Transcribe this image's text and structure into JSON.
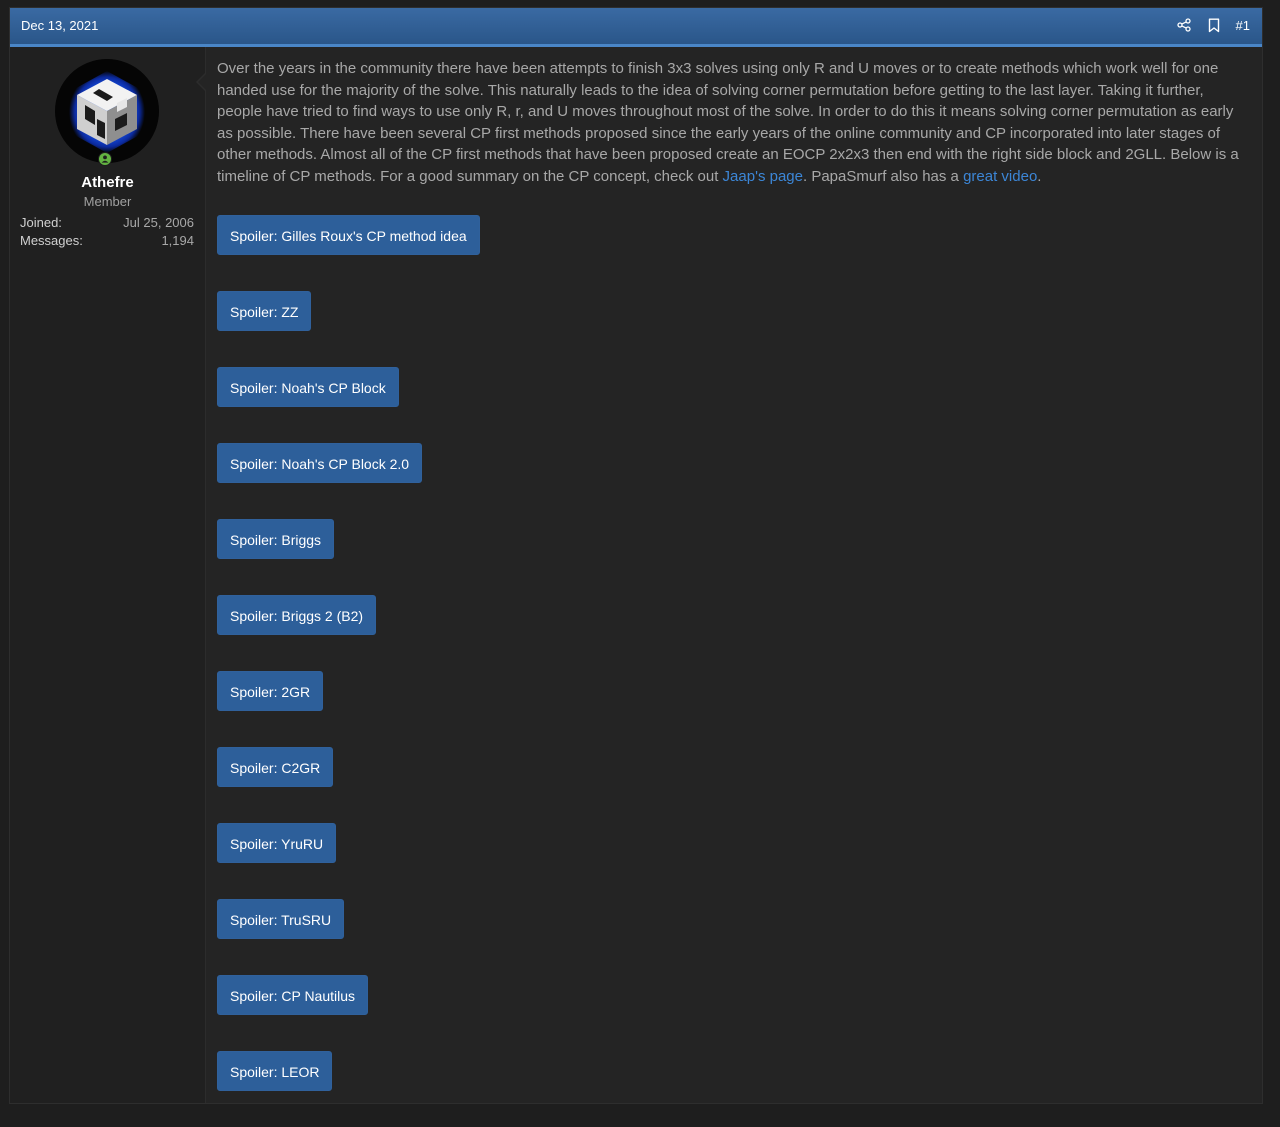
{
  "post": {
    "date": "Dec 13, 2021",
    "number": "#1",
    "share_icon": "share-icon",
    "bookmark_icon": "bookmark-icon"
  },
  "user": {
    "avatar_icon": "cube-logo-avatar",
    "online_status": "online",
    "name": "Athefre",
    "title": "Member",
    "stats": [
      {
        "label": "Joined:",
        "value": "Jul 25, 2006"
      },
      {
        "label": "Messages:",
        "value": "1,194"
      }
    ]
  },
  "body": {
    "text_1": "Over the years in the community there have been attempts to finish 3x3 solves using only R and U moves or to create methods which work well for one handed use for the majority of the solve. This naturally leads to the idea of solving corner permutation before getting to the last layer. Taking it further, people have tried to find ways to use only R, r, and U moves throughout most of the solve. In order to do this it means solving corner permutation as early as possible. There have been several CP first methods proposed since the early years of the online community and CP incorporated into later stages of other methods. Almost all of the CP first methods that have been proposed create an EOCP 2x2x3 then end with the right side block and 2GLL. Below is a timeline of CP methods. For a good summary on the CP concept, check out ",
    "link_1": "Jaap's page",
    "text_2": ". PapaSmurf also has a ",
    "link_2": "great video",
    "text_3": "."
  },
  "spoilers": [
    "Spoiler: Gilles Roux's CP method idea",
    "Spoiler: ZZ",
    "Spoiler: Noah's CP Block",
    "Spoiler: Noah's CP Block 2.0",
    "Spoiler: Briggs",
    "Spoiler: Briggs 2 (B2)",
    "Spoiler: 2GR",
    "Spoiler: C2GR",
    "Spoiler: YruRU",
    "Spoiler: TruSRU",
    "Spoiler: CP Nautilus",
    "Spoiler: LEOR"
  ],
  "colors": {
    "header": "#2f5f98",
    "accent": "#4a86c7",
    "button": "#2d5f9a",
    "link": "#3c86d6",
    "online": "#63b342"
  }
}
